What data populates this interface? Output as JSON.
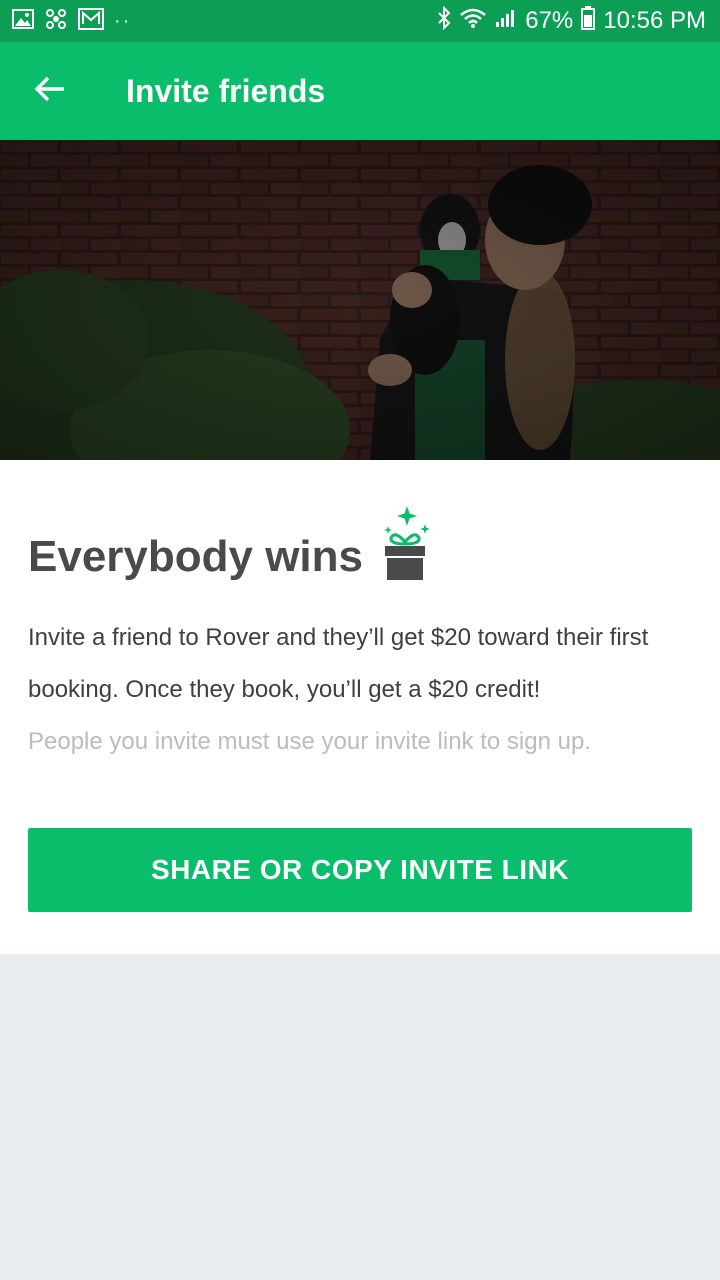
{
  "status_bar": {
    "dots": "··",
    "battery": "67%",
    "time": "10:56 PM"
  },
  "app_bar": {
    "title": "Invite friends"
  },
  "content": {
    "heading": "Everybody wins",
    "body": "Invite a friend to Rover and they’ll get $20 toward their first booking. Once they book, you’ll get a $20 credit!",
    "note": "People you invite must use your invite link to sign up.",
    "share_button": "SHARE OR COPY INVITE LINK"
  },
  "colors": {
    "status_bar": "#0c9e54",
    "app_bar": "#0abd6b",
    "button": "#0abd6b",
    "heading": "#4a4a4a",
    "note": "#b9bcc0",
    "background": "#e8ecee"
  },
  "icons": [
    "image-icon",
    "fan-icon",
    "mail-icon",
    "bluetooth-icon",
    "wifi-icon",
    "signal-icon",
    "battery-icon",
    "back-arrow-icon",
    "gift-icon",
    "sparkle-icon"
  ]
}
